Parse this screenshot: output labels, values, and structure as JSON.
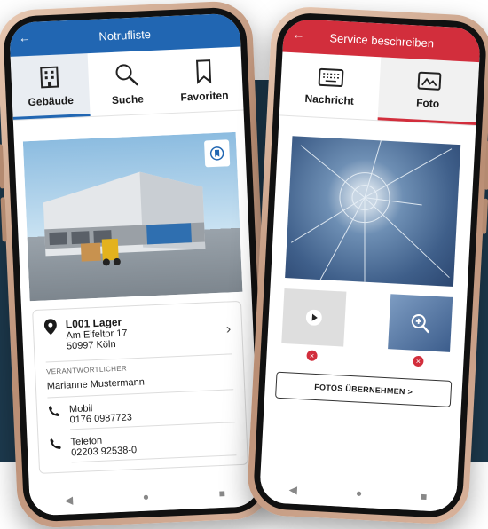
{
  "colors": {
    "accent_blue": "#2166b2",
    "accent_red": "#d22e3c",
    "backdrop": "#1d3a4e",
    "frame": "#c9a089"
  },
  "left_phone": {
    "header": {
      "back_icon": "back-arrow-icon",
      "title": "Notrufliste"
    },
    "tabs": [
      {
        "label": "Gebäude",
        "icon": "building-icon",
        "active": true
      },
      {
        "label": "Suche",
        "icon": "search-icon",
        "active": false
      },
      {
        "label": "Favoriten",
        "icon": "bookmark-icon",
        "active": false
      }
    ],
    "location": {
      "name": "L001 Lager",
      "street": "Am Eifeltor 17",
      "city": "50997 Köln"
    },
    "responsible_label": "VERANTWORTLICHER",
    "person_name": "Marianne Mustermann",
    "contacts": [
      {
        "label": "Mobil",
        "value": "0176 0987723"
      },
      {
        "label": "Telefon",
        "value": "02203 92538-0"
      }
    ],
    "nav": {
      "back": "◀",
      "home": "●",
      "recent": "■"
    }
  },
  "right_phone": {
    "header": {
      "back_icon": "back-arrow-icon",
      "title": "Service beschreiben"
    },
    "tabs": [
      {
        "label": "Nachricht",
        "icon": "keyboard-icon",
        "active": false
      },
      {
        "label": "Foto",
        "icon": "image-icon",
        "active": true
      }
    ],
    "fotos_button": "FOTOS ÜBERNEHMEN >",
    "delete_glyph": "×",
    "nav": {
      "back": "◀",
      "home": "●",
      "recent": "■"
    }
  }
}
